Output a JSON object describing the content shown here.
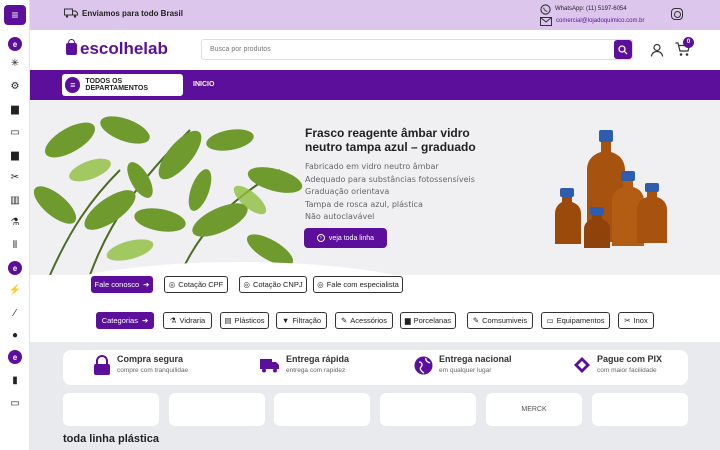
{
  "topbar": {
    "shipping": "Enviamos para todo Brasil",
    "whatsapp": "WhatsApp: (11) 5197-6054",
    "email": "comercial@lojadoquimico.com.br"
  },
  "header": {
    "logo": "escolhelab",
    "search_placeholder": "Busca por produtos",
    "cart_count": "0"
  },
  "nav": {
    "departments": "TODOS OS DEPARTAMENTOS",
    "home": "INICIO"
  },
  "hero": {
    "title": "Frasco reagente âmbar vidro neutro tampa azul – graduado",
    "features": [
      "Fabricado em vidro neutro âmbar",
      "Adequado para substâncias fotossensíveis",
      "Graduação orientava",
      "Tampa de rosca azul, plástica",
      "Não autoclavável"
    ],
    "cta": "veja toda linha"
  },
  "contact_buttons": {
    "fale_conosco": "Fale conosco",
    "cotacao_cpf": "Cotação CPF",
    "cotacao_cnpj": "Cotação CNPJ",
    "especialista": "Fale com especialista"
  },
  "categories": {
    "label": "Categorias",
    "items": [
      "Vidraria",
      "Plásticos",
      "Filtração",
      "Acessórios",
      "Porcelanas",
      "Comsumiveis",
      "Equipamentos",
      "Inox"
    ]
  },
  "benefits": [
    {
      "title": "Compra segura",
      "sub": "compre com tranquilidae"
    },
    {
      "title": "Entrega rápida",
      "sub": "entrega com rapidez"
    },
    {
      "title": "Entrega nacional",
      "sub": "em qualquer lugar"
    },
    {
      "title": "Pague com PIX",
      "sub": "com maior facilidade"
    }
  ],
  "brands": [
    "",
    "",
    "",
    "",
    "MERCK",
    ""
  ],
  "section": {
    "title": "toda linha plástica"
  },
  "colors": {
    "brand": "#5b0f9a",
    "topbar": "#dcc6ec"
  }
}
